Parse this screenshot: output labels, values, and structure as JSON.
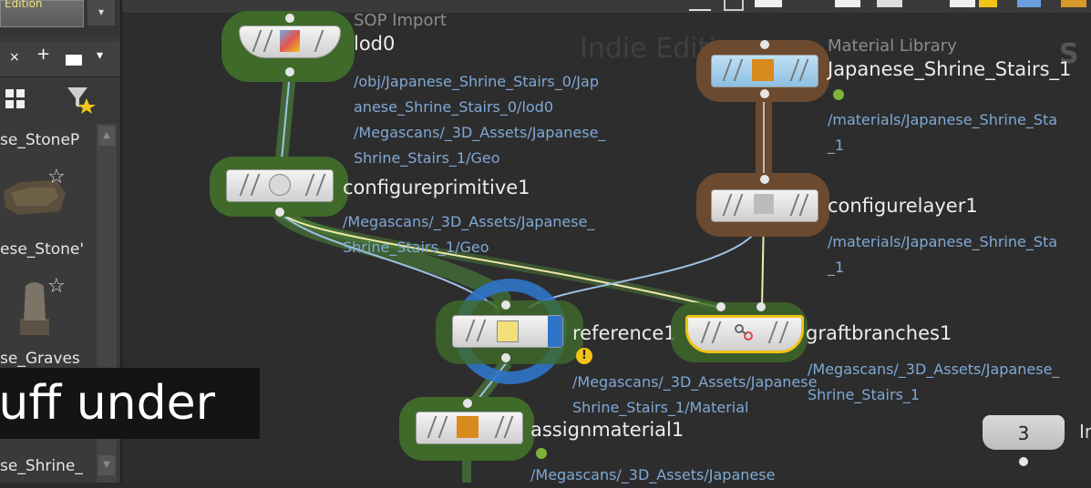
{
  "left_panel": {
    "edition_chip": "Edition",
    "dropdown": "▾",
    "tab_close": "×",
    "tab_add": "+",
    "tab_menu": "▾",
    "assets": [
      {
        "label": "se_StoneP"
      },
      {
        "label": "ese_Stone'"
      },
      {
        "label": "se_Graves"
      },
      {
        "label": "se_Shrine_"
      }
    ]
  },
  "subtitle": "tuff under",
  "watermark": "Indie Edition",
  "corner_letter": "S",
  "nodes": {
    "lod0": {
      "name": "lod0",
      "context_title": "SOP Import",
      "paths": [
        "/obj/Japanese_Shrine_Stairs_0/Jap",
        "anese_Shrine_Stairs_0/lod0",
        "/Megascans/_3D_Assets/Japanese_",
        "Shrine_Stairs_1/Geo"
      ]
    },
    "configureprimitive1": {
      "name": "configureprimitive1",
      "paths": [
        "/Megascans/_3D_Assets/Japanese_",
        "Shrine_Stairs_1/Geo"
      ]
    },
    "material_library": {
      "name": "Japanese_Shrine_Stairs_1",
      "context_title": "Material Library",
      "paths": [
        "/materials/Japanese_Shrine_Sta",
        "_1"
      ]
    },
    "configurelayer1": {
      "name": "configurelayer1",
      "paths": [
        "/materials/Japanese_Shrine_Sta",
        "_1"
      ]
    },
    "reference1": {
      "name": "reference1",
      "paths": [
        "/Megascans/_3D_Assets/Japanese",
        "Shrine_Stairs_1/Material"
      ]
    },
    "graftbranches1": {
      "name": "graftbranches1",
      "paths": [
        "/Megascans/_3D_Assets/Japanese_",
        "Shrine_Stairs_1"
      ]
    },
    "assignmaterial1": {
      "name": "assignmaterial1",
      "paths": [
        "/Megascans/_3D_Assets/Japanese"
      ]
    }
  },
  "counter": {
    "value": "3",
    "label": "In"
  },
  "colors": {
    "accent_green": "#7fb43a",
    "path_blue": "#7fa9d6",
    "halo_green": "#3f6a2a",
    "halo_brown": "#6b4a30",
    "selected_blue": "#2f74c8"
  }
}
